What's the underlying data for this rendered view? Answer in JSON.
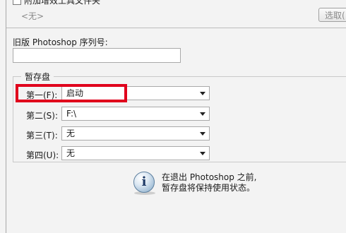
{
  "plugins": {
    "additional_folder_label": "附加增效工具文件夹",
    "folder_value": "<无>",
    "choose_button": "选取("
  },
  "serial": {
    "label": "旧版 Photoshop 序列号:",
    "value": ""
  },
  "scratch": {
    "group_title": "暂存盘",
    "rows": [
      {
        "label": "第一(F):",
        "value": "启动"
      },
      {
        "label": "第二(S):",
        "value": "F:\\"
      },
      {
        "label": "第三(T):",
        "value": "无"
      },
      {
        "label": "第四(U):",
        "value": "无"
      }
    ]
  },
  "info": {
    "line1": "在退出 Photoshop 之前,",
    "line2": "暂存盘将保持使用状态。"
  },
  "colors": {
    "highlight": "#e0001c"
  }
}
